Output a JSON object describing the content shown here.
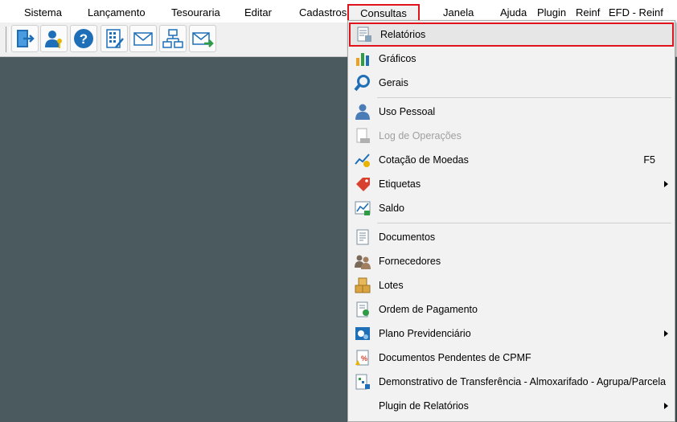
{
  "menubar": {
    "items": [
      {
        "label": "Sistema"
      },
      {
        "label": "Lançamento"
      },
      {
        "label": "Tesouraria"
      },
      {
        "label": "Editar"
      },
      {
        "label": "Cadastros"
      },
      {
        "label": "Consultas"
      },
      {
        "label": "Janela"
      },
      {
        "label": "Ajuda"
      },
      {
        "label": "Plugin"
      },
      {
        "label": "Reinf"
      },
      {
        "label": "EFD - Reinf"
      }
    ]
  },
  "toolbar": {
    "buttons": [
      {
        "icon": "exit-door-icon"
      },
      {
        "icon": "user-key-icon"
      },
      {
        "icon": "help-icon"
      },
      {
        "icon": "calculator-document-icon"
      },
      {
        "icon": "envelope-icon"
      },
      {
        "icon": "network-icon"
      },
      {
        "icon": "send-mail-icon"
      }
    ]
  },
  "consultas_menu": {
    "items": [
      {
        "label": "Relatórios",
        "icon": "report-icon",
        "highlighted": true
      },
      {
        "label": "Gráficos",
        "icon": "bar-chart-icon"
      },
      {
        "label": "Gerais",
        "icon": "magnifier-icon"
      },
      {
        "label": "Uso Pessoal",
        "icon": "person-icon"
      },
      {
        "label": "Log de Operações",
        "icon": "log-icon",
        "disabled": true
      },
      {
        "label": "Cotação de Moedas",
        "icon": "currency-chart-icon",
        "shortcut": "F5"
      },
      {
        "label": "Etiquetas",
        "icon": "price-tag-icon",
        "submenu": true
      },
      {
        "label": "Saldo",
        "icon": "balance-chart-icon"
      },
      {
        "label": "Documentos",
        "icon": "document-icon"
      },
      {
        "label": "Fornecedores",
        "icon": "suppliers-icon"
      },
      {
        "label": "Lotes",
        "icon": "boxes-icon"
      },
      {
        "label": "Ordem de Pagamento",
        "icon": "payment-order-icon"
      },
      {
        "label": "Plano Previdenciário",
        "icon": "pension-plan-icon",
        "submenu": true
      },
      {
        "label": "Documentos Pendentes de CPMF",
        "icon": "pending-docs-icon"
      },
      {
        "label": "Demonstrativo de Transferência - Almoxarifado - Agrupa/Parcela",
        "icon": "transfer-statement-icon"
      },
      {
        "label": "Plugin de Relatórios",
        "icon": "none",
        "submenu": true
      }
    ]
  },
  "colors": {
    "workspace": "#4a5a5e",
    "highlight_border": "#e0121c",
    "menu_bg": "#f2f2f2"
  }
}
